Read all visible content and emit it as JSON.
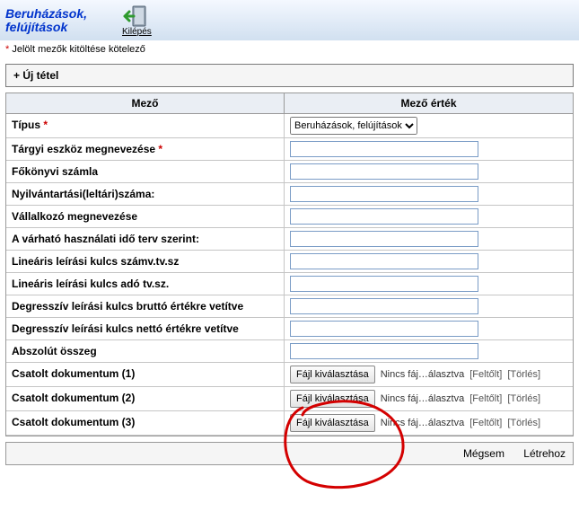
{
  "title": "Beruházások, felújítások",
  "exit_label": "Kilépés",
  "required_note": "Jelölt mezők kitöltése kötelező",
  "new_item": "+ Új tétel",
  "columns": {
    "field": "Mező",
    "value": "Mező érték"
  },
  "type": {
    "label": "Típus",
    "required": true,
    "selected": "Beruházások, felújítások",
    "options": [
      "Beruházások, felújítások"
    ]
  },
  "rows": [
    {
      "label": "Tárgyi eszköz megnevezése",
      "required": true,
      "value": ""
    },
    {
      "label": "Főkönyvi számla",
      "value": ""
    },
    {
      "label": "Nyilvántartási(leltári)száma:",
      "value": ""
    },
    {
      "label": "Vállalkozó megnevezése",
      "value": ""
    },
    {
      "label": "A várható használati idő terv szerint:",
      "value": ""
    },
    {
      "label": "Lineáris leírási kulcs számv.tv.sz",
      "value": ""
    },
    {
      "label": "Lineáris leírási kulcs adó tv.sz.",
      "value": ""
    },
    {
      "label": "Degresszív leírási kulcs bruttó értékre vetítve",
      "value": ""
    },
    {
      "label": "Degresszív leírási kulcs nettó értékre vetítve",
      "value": ""
    },
    {
      "label": "Abszolút összeg",
      "value": ""
    }
  ],
  "attachments": [
    {
      "label": "Csatolt dokumentum (1)"
    },
    {
      "label": "Csatolt dokumentum (2)"
    },
    {
      "label": "Csatolt dokumentum (3)"
    }
  ],
  "file_button": "Fájl kiválasztása",
  "file_status": "Nincs fáj…álasztva",
  "upload_link": "[Feltőlt]",
  "delete_link": "[Törlés]",
  "actions": {
    "cancel": "Mégsem",
    "create": "Létrehoz"
  }
}
